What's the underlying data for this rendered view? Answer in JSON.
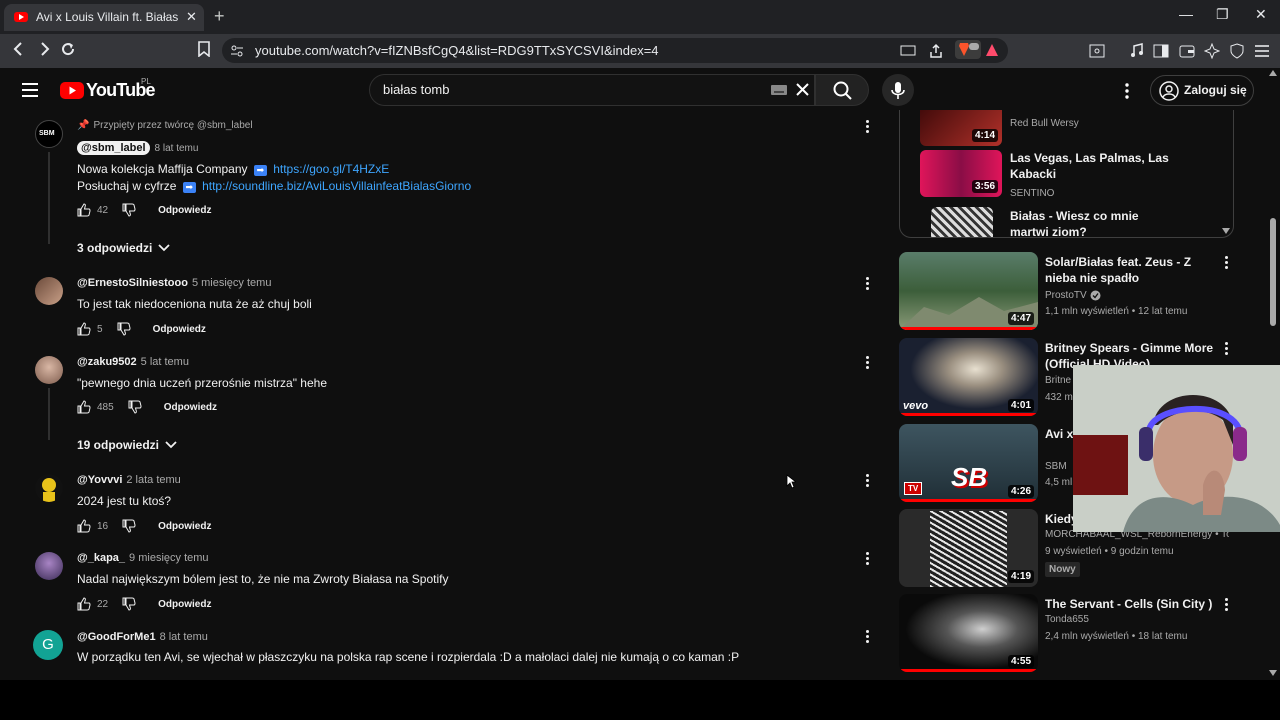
{
  "browser": {
    "tab_title": "Avi x Louis Villain ft. Białas - Gior",
    "url": "youtube.com/watch?v=fIZNBsfCgQ4&list=RDG9TTxSYCSVI&index=4"
  },
  "youtube": {
    "logo_text": "YouTube",
    "region": "PL",
    "search_value": "białas tomb",
    "login_label": "Zaloguj się"
  },
  "comments": {
    "pinned": {
      "pinned_label": "Przypięty przez twórcę @sbm_label",
      "author": "@sbm_label",
      "time": "8 lat temu",
      "line1_text": "Nowa kolekcja Maffija Company",
      "line1_link": "https://goo.gl/T4HZxE",
      "line2_text": "Posłuchaj w cyfrze",
      "line2_link": "http://soundline.biz/AviLouisVillainfeatBialasGiorno",
      "likes": "42",
      "reply_label": "Odpowiedz",
      "replies_label": "3 odpowiedzi"
    },
    "items": [
      {
        "author": "@ErnestoSilniestooo",
        "time": "5 miesięcy temu",
        "text": "To jest tak niedoceniona nuta że aż chuj boli",
        "likes": "5",
        "reply_label": "Odpowiedz"
      },
      {
        "author": "@zaku9502",
        "time": "5 lat temu",
        "text": "\"pewnego dnia uczeń przerośnie mistrza\" hehe",
        "likes": "485",
        "reply_label": "Odpowiedz",
        "replies_label": "19 odpowiedzi"
      },
      {
        "author": "@Yovvvi",
        "time": "2 lata temu",
        "text": "2024 jest tu ktoś?",
        "likes": "16",
        "reply_label": "Odpowiedz"
      },
      {
        "author": "@_kapa_",
        "time": "9 miesięcy temu",
        "text": "Nadal największym bólem jest to, że nie ma Zwroty Białasa na Spotify",
        "likes": "22",
        "reply_label": "Odpowiedz"
      },
      {
        "author": "@GoodForMe1",
        "time": "8 lat temu",
        "text": "W porządku ten Avi, se wjechał w płaszczyku na polska rap scene i rozpierdala :D a małolaci dalej nie kumają o co kaman :P",
        "avatar_letter": "G"
      }
    ]
  },
  "playlist": {
    "items": [
      {
        "duration": "4:14",
        "channel": "Red Bull Wersy"
      },
      {
        "title": "Las Vegas, Las Palmas, Las Kabacki",
        "duration": "3:56",
        "channel": "SENTINO"
      },
      {
        "title": "Białas - Wiesz co mnie martwi ziom?"
      }
    ]
  },
  "recommended": [
    {
      "title": "Solar/Białas feat. Zeus - Z nieba nie spadło",
      "channel": "ProstoTV",
      "meta": "1,1 mln wyświetleń • 12 lat temu",
      "duration": "4:47"
    },
    {
      "title": "Britney Spears - Gimme More (Official HD Video)",
      "channel": "Britne",
      "meta": "432 m",
      "duration": "4:01",
      "thumb_logo": "vevo"
    },
    {
      "title": "Avi x Chris",
      "channel": "SBM",
      "meta": "4,5 ml",
      "duration": "4:26",
      "thumb_logo": "SB",
      "thumb_badge": "TV"
    },
    {
      "title": "Kiedy",
      "channel": "MORCHABAAL_WSL_RebornEnergy • To...",
      "meta": "9 wyświetleń • 9 godzin temu",
      "duration": "4:19",
      "badge": "Nowy"
    },
    {
      "title": "The Servant - Cells (Sin City )",
      "channel": "Tonda655",
      "meta": "2,4 mln wyświetleń • 18 lat temu",
      "duration": "4:55"
    }
  ]
}
